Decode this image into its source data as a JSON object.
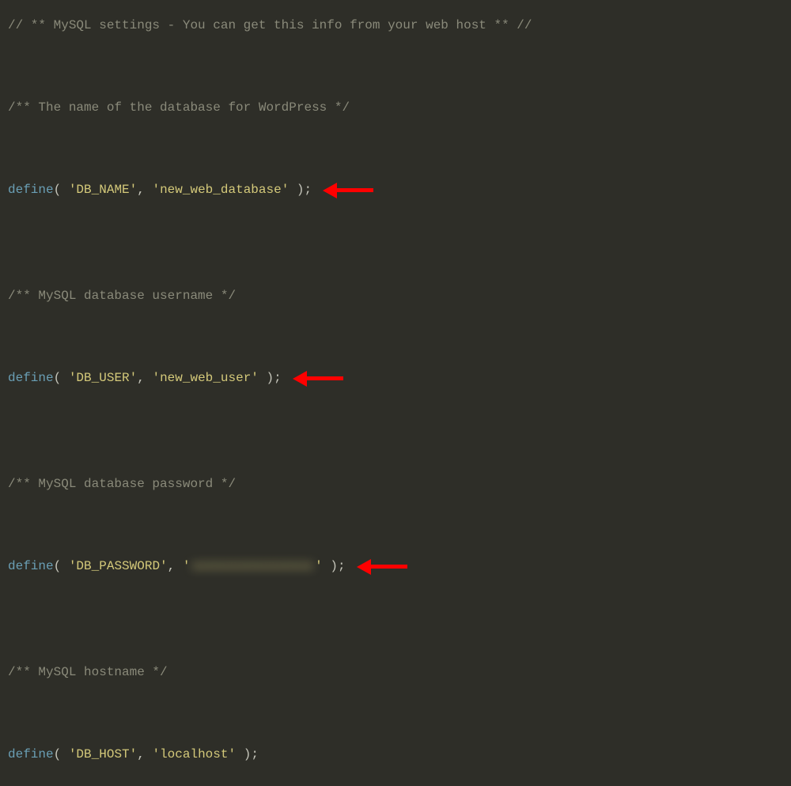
{
  "code": {
    "comment_header": "// ** MySQL settings - You can get this info from your web host ** //",
    "comment_dbname": "/** The name of the database for WordPress */",
    "comment_dbuser": "/** MySQL database username */",
    "comment_dbpass": "/** MySQL database password */",
    "comment_dbhost": "/** MySQL hostname */",
    "fn_define": "define",
    "paren_open": "(",
    "paren_close": ")",
    "semicolon": ";",
    "comma": ",",
    "space": " ",
    "dbname_key": "'DB_NAME'",
    "dbname_val": "'new_web_database'",
    "dbuser_key": "'DB_USER'",
    "dbuser_val": "'new_web_user'",
    "dbpass_key": "'DB_PASSWORD'",
    "dbpass_val_quote_open": "'",
    "dbpass_val_hidden": "xxxxxxxxxxxxxxxx",
    "dbpass_val_quote_close": "'",
    "dbhost_key": "'DB_HOST'",
    "dbhost_val": "'localhost'"
  }
}
